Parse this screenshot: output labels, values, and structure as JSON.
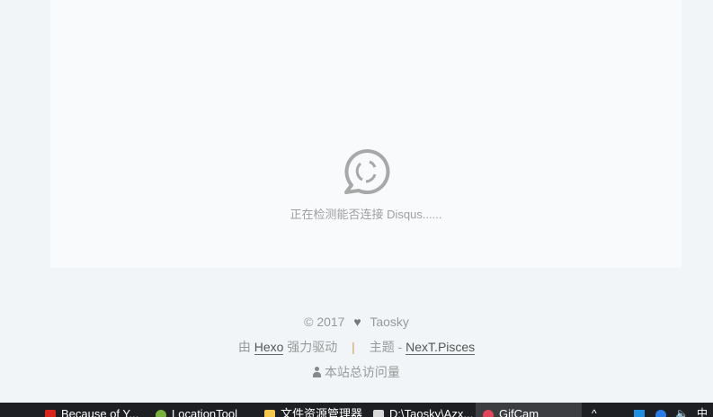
{
  "comments": {
    "loading_text": "正在检测能否连接 Disqus......"
  },
  "footer": {
    "copyright": "© 2017",
    "author": "Taosky",
    "powered_prefix": "由",
    "powered_link": "Hexo",
    "powered_suffix": "强力驱动",
    "separator": "|",
    "theme_prefix": "主题 -",
    "theme_link": "NexT.Pisces",
    "visits_label": "本站总访问量"
  },
  "taskbar": {
    "items": [
      {
        "label": "Because of Y...",
        "color": "#d9261c"
      },
      {
        "label": "LocationTool",
        "color": "#7ab03e"
      },
      {
        "label": "文件资源管理器",
        "color": "#f2c94c"
      },
      {
        "label": "D:\\Taosky\\Azx...",
        "color": "#d8d8d8"
      },
      {
        "label": "GifCam",
        "color": "#e2445c"
      }
    ],
    "tray": {
      "chevron": "^",
      "ime": "中"
    }
  }
}
